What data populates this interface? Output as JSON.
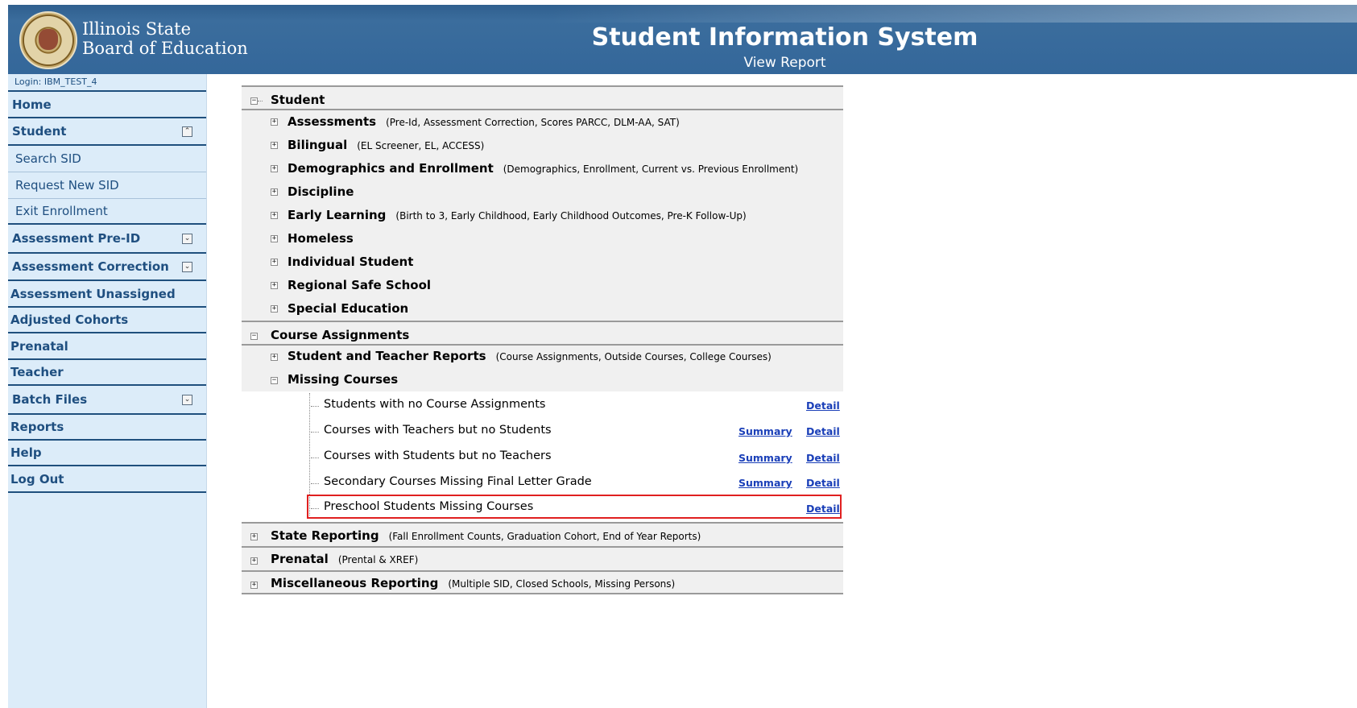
{
  "header": {
    "agency_line1": "Illinois State",
    "agency_line2": "Board of Education",
    "title": "Student Information System",
    "subtitle": "View Report",
    "logo": "illinois-state-seal"
  },
  "sidebar": {
    "login": "Login: IBM_TEST_4",
    "items": [
      {
        "label": "Home"
      },
      {
        "label": "Student",
        "expandable": true,
        "expanded": true
      },
      {
        "label": "Search SID",
        "sub": true
      },
      {
        "label": "Request New SID",
        "sub": true
      },
      {
        "label": "Exit Enrollment",
        "sub": true
      },
      {
        "label": "Assessment Pre-ID",
        "expandable": true
      },
      {
        "label": "Assessment Correction",
        "expandable": true
      },
      {
        "label": "Assessment Unassigned"
      },
      {
        "label": "Adjusted Cohorts"
      },
      {
        "label": "Prenatal"
      },
      {
        "label": "Teacher"
      },
      {
        "label": "Batch Files",
        "expandable": true
      },
      {
        "label": "Reports"
      },
      {
        "label": "Help"
      },
      {
        "label": "Log Out"
      }
    ]
  },
  "tree": {
    "student": {
      "label": "Student",
      "children": [
        {
          "label": "Assessments",
          "hint": "(Pre-Id, Assessment Correction, Scores PARCC, DLM-AA, SAT)"
        },
        {
          "label": "Bilingual",
          "hint": "(EL Screener, EL, ACCESS)"
        },
        {
          "label": "Demographics and Enrollment",
          "hint": "(Demographics, Enrollment, Current vs. Previous Enrollment)"
        },
        {
          "label": "Discipline",
          "hint": ""
        },
        {
          "label": "Early Learning",
          "hint": "(Birth to 3, Early Childhood, Early Childhood Outcomes, Pre-K Follow-Up)"
        },
        {
          "label": "Homeless",
          "hint": ""
        },
        {
          "label": "Individual Student",
          "hint": ""
        },
        {
          "label": "Regional Safe School",
          "hint": ""
        },
        {
          "label": "Special Education",
          "hint": ""
        }
      ]
    },
    "course_assignments": {
      "label": "Course Assignments",
      "student_teacher": {
        "label": "Student and Teacher Reports",
        "hint": "(Course Assignments, Outside Courses, College Courses)"
      },
      "missing_courses": {
        "label": "Missing Courses",
        "reports": [
          {
            "label": "Students with no Course Assignments",
            "summary": "",
            "detail": "Detail"
          },
          {
            "label": "Courses with Teachers but no Students",
            "summary": "Summary",
            "detail": "Detail"
          },
          {
            "label": "Courses with Students but no Teachers",
            "summary": "Summary",
            "detail": "Detail"
          },
          {
            "label": "Secondary Courses Missing Final Letter Grade",
            "summary": "Summary",
            "detail": "Detail"
          },
          {
            "label": "Preschool Students Missing Courses",
            "summary": "",
            "detail": "Detail"
          }
        ]
      }
    },
    "state_reporting": {
      "label": "State Reporting",
      "hint": "(Fall Enrollment Counts, Graduation Cohort, End of Year Reports)"
    },
    "prenatal": {
      "label": "Prenatal",
      "hint": "(Prental & XREF)"
    },
    "misc": {
      "label": "Miscellaneous Reporting",
      "hint": "(Multiple SID, Closed Schools, Missing Persons)"
    }
  },
  "colors": {
    "header_bg": "#34689a",
    "sidebar_bg": "#dcecf9",
    "nav_text": "#1f4f80",
    "link": "#1a3fb8",
    "highlight_box": "#e02020"
  }
}
